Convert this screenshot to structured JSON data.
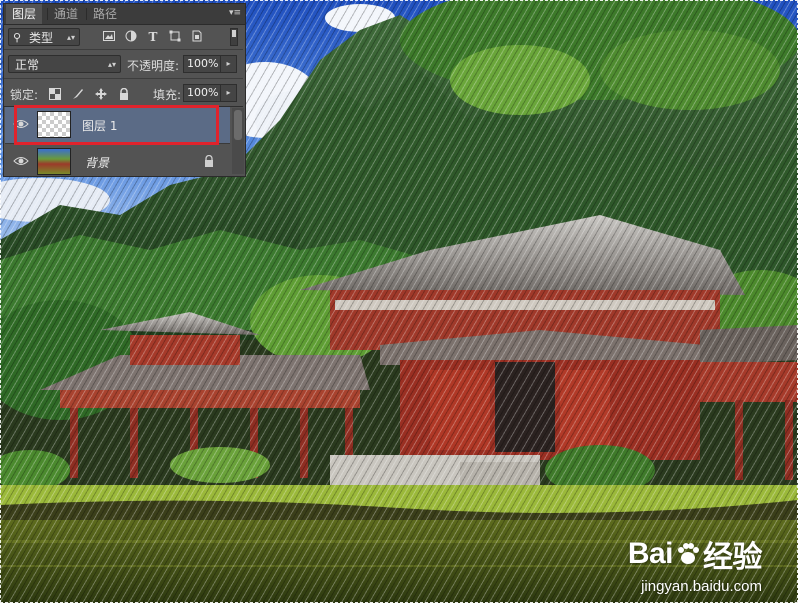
{
  "panel": {
    "tabs": [
      "图层",
      "通道",
      "路径"
    ],
    "active_tab": 0,
    "filter": {
      "kind_label": "类型"
    },
    "blend_mode": "正常",
    "opacity_label": "不透明度:",
    "opacity_value": "100%",
    "lock_label": "锁定:",
    "fill_label": "填充:",
    "fill_value": "100%",
    "menu_icon": "panel-menu-icon"
  },
  "layers": [
    {
      "name": "图层 1",
      "selected": true,
      "thumbnail": "transparent-checkerboard",
      "visible": true
    },
    {
      "name": "背景",
      "selected": false,
      "thumbnail": "temple-photo",
      "visible": true,
      "locked": true
    }
  ],
  "highlight_color": "#e0232c",
  "watermark": {
    "brand_prefix": "Bai",
    "brand_suffix": "经验",
    "url": "jingyan.baidu.com"
  },
  "colors": {
    "panel_bg": "#535353",
    "tab_bar": "#3c3c3c",
    "selected_layer": "#5b6b86"
  }
}
